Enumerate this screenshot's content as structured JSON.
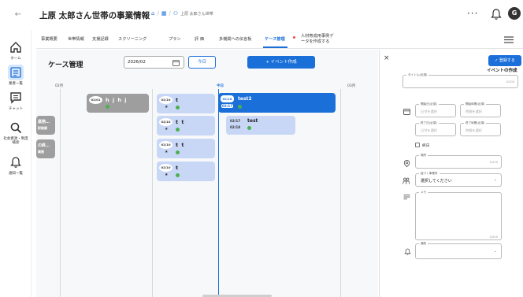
{
  "header": {
    "title": "上原 太郎さん世帯の事業情報",
    "crumb_text": "上原 太郎さん世帯",
    "more_label": "···",
    "avatar_letter": "G"
  },
  "sidebar": {
    "items": [
      {
        "label": "ホーム",
        "icon": "home-icon"
      },
      {
        "label": "業者一覧",
        "icon": "list-icon"
      },
      {
        "label": "チャット",
        "icon": "chat-icon"
      },
      {
        "label": "社会資源・制度検索",
        "icon": "search-icon"
      },
      {
        "label": "通知一覧",
        "icon": "bell-icon"
      }
    ]
  },
  "tabs": [
    {
      "label": "事業概要"
    },
    {
      "label": "世帯情報"
    },
    {
      "label": "支援記録"
    },
    {
      "label": "スクリーニング"
    },
    {
      "label": "プラン"
    },
    {
      "label": "評 価"
    },
    {
      "label": "多機関への伝言板"
    },
    {
      "label": "ケース管理",
      "active": true
    },
    {
      "label": "人材育成用事例データを作成する"
    }
  ],
  "main": {
    "title": "ケース管理",
    "month_value": "2026/02",
    "today_label": "今日",
    "event_button": "+ イベント作成",
    "columns": [
      {
        "label": "02月"
      },
      {
        "label": "今日"
      },
      {
        "label": "03月"
      }
    ],
    "cards": [
      {
        "date": "02/01",
        "name": "h j h j"
      },
      {
        "date": "02/10",
        "name": "t",
        "star": "★"
      },
      {
        "date": "02/10",
        "name": "t t",
        "star": "★"
      },
      {
        "date": "02/10",
        "name": "t t",
        "star": "★"
      },
      {
        "date": "02/10",
        "name": "t",
        "star": "★"
      },
      {
        "date": "02/16",
        "date2": "02/17",
        "name": "test2"
      },
      {
        "date": "02/17",
        "date2": "02/18",
        "name": "test"
      },
      {
        "line1": "業務…",
        "line2": "財務業"
      },
      {
        "line1": "の終…",
        "line2": "業務"
      }
    ]
  },
  "panel": {
    "close": "×",
    "register_label": "✓ 登録する",
    "heading": "イベントの作成",
    "title_field": {
      "label": "タイトル(必須)",
      "counter": "0/100"
    },
    "start_date": {
      "label": "開始日(必須)",
      "placeholder": "日付を選択"
    },
    "start_time": {
      "label": "開始時間(必須)",
      "placeholder": "時間を選択"
    },
    "end_date": {
      "label": "終了日(必須)",
      "placeholder": "日付を選択"
    },
    "end_time": {
      "label": "終了時間(必須)",
      "placeholder": "時間を選択"
    },
    "allday": "終日",
    "place_field": {
      "label": "場所",
      "counter": "0/100"
    },
    "target_field": {
      "label": "紐づく事業所",
      "value": "選択してください"
    },
    "memo_field": {
      "label": "メモ",
      "counter": "0/500"
    },
    "notify_field": {
      "label": "通知"
    }
  }
}
